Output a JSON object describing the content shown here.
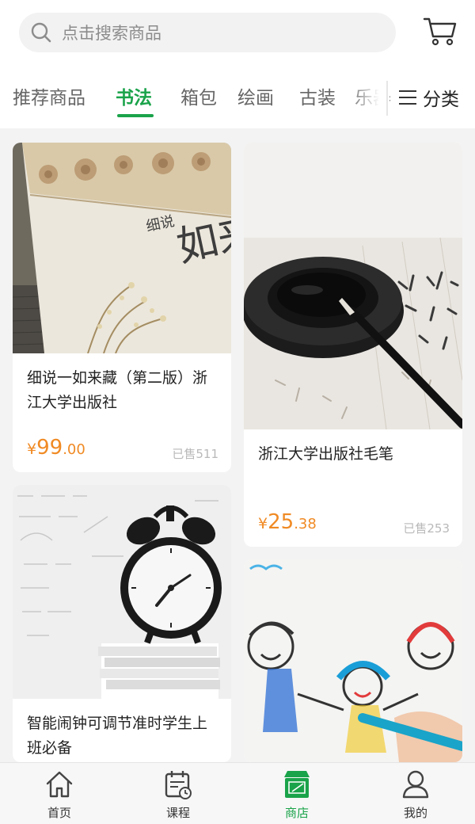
{
  "search": {
    "placeholder": "点击搜索商品"
  },
  "tabs": [
    {
      "label": "推荐商品",
      "active": false
    },
    {
      "label": "书法",
      "active": true
    },
    {
      "label": "箱包",
      "active": false
    },
    {
      "label": "绘画",
      "active": false
    },
    {
      "label": "古装",
      "active": false
    },
    {
      "label": "乐器",
      "active": false
    }
  ],
  "category_button": {
    "label": "分类"
  },
  "products": [
    {
      "title": "细说一如来藏（第二版）浙江大学出版社",
      "currency": "¥",
      "price_int": "99",
      "price_dec": ".00",
      "sold": "已售511",
      "image": "book-cover"
    },
    {
      "title": "浙江大学出版社毛笔",
      "currency": "¥",
      "price_int": "25",
      "price_dec": ".38",
      "sold": "已售253",
      "image": "inkstone-brush"
    },
    {
      "title": "智能闹钟可调节准时学生上班必备",
      "currency": "",
      "price_int": "",
      "price_dec": "",
      "sold": "",
      "image": "alarm-clock"
    },
    {
      "title": "",
      "currency": "",
      "price_int": "",
      "price_dec": "",
      "sold": "",
      "image": "crayon-drawing"
    }
  ],
  "book_cover_text": {
    "main": "如来藏",
    "sub": "细说"
  },
  "bottom_nav": [
    {
      "label": "首页",
      "icon": "home-icon",
      "active": false
    },
    {
      "label": "课程",
      "icon": "calendar-clock-icon",
      "active": false
    },
    {
      "label": "商店",
      "icon": "store-icon",
      "active": true
    },
    {
      "label": "我的",
      "icon": "user-icon",
      "active": false
    }
  ],
  "colors": {
    "accent": "#1aa34a",
    "price": "#f08a24",
    "background": "#f3f3f3"
  }
}
